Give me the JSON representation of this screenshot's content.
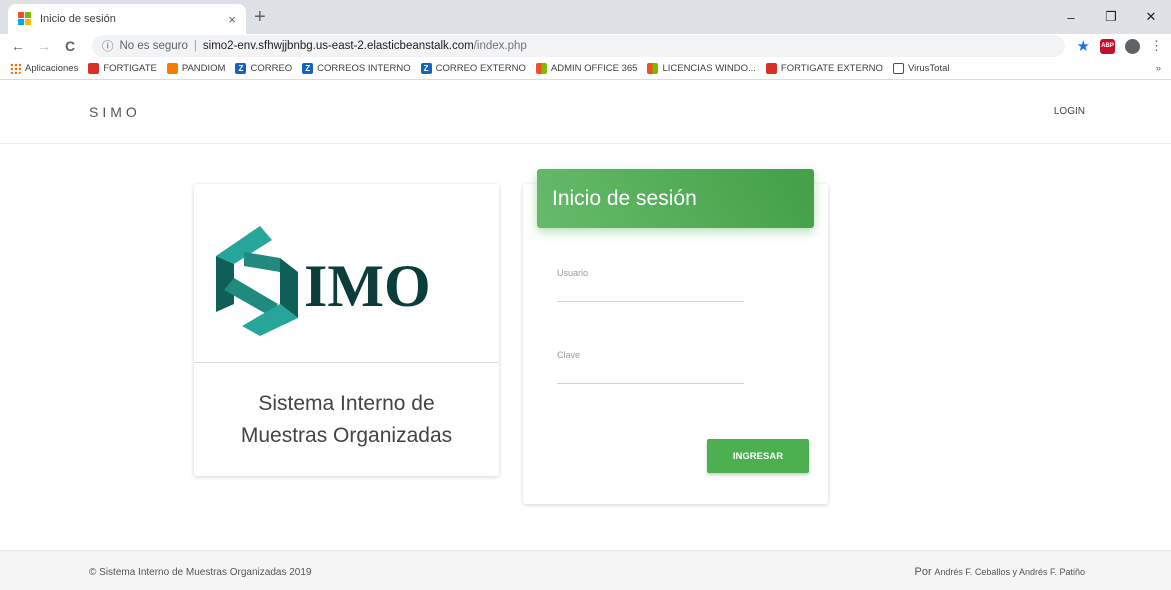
{
  "browser": {
    "tab_title": "Inicio de sesión",
    "tab_close": "×",
    "new_tab": "+",
    "window_controls": [
      "–",
      "❐",
      "✕"
    ],
    "nav": {
      "back": "←",
      "forward": "→",
      "reload": "C"
    },
    "security_icon": "ⓘ",
    "security_text": "No es seguro",
    "url_host": "simo2-env.sfhwjjbnbg.us-east-2.elasticbeanstalk.com",
    "url_path": "/index.php",
    "abp_label": "ABP",
    "bookmarks": [
      {
        "label": "Aplicaciones",
        "icon": "apps-icon"
      },
      {
        "label": "FORTIGATE",
        "icon": "fortigate-icon"
      },
      {
        "label": "PANDIOM",
        "icon": "pandiom-icon"
      },
      {
        "label": "CORREO",
        "icon": "zimbra-icon"
      },
      {
        "label": "CORREOS INTERNO",
        "icon": "zimbra-icon"
      },
      {
        "label": "CORREO EXTERNO",
        "icon": "zimbra-icon"
      },
      {
        "label": "ADMIN OFFICE 365",
        "icon": "microsoft-icon"
      },
      {
        "label": "LICENCIAS WINDO...",
        "icon": "microsoft-icon"
      },
      {
        "label": "FORTIGATE EXTERNO",
        "icon": "fortigate-icon"
      },
      {
        "label": "VirusTotal",
        "icon": "virustotal-icon"
      }
    ],
    "bookmarks_more": "»"
  },
  "site": {
    "brand": "SIMO",
    "login_link": "LOGIN",
    "logo_text": "IMO",
    "caption_line1": "Sistema Interno de",
    "caption_line2": "Muestras Organizadas",
    "form_title": "Inicio de sesión",
    "user_label": "Usuario",
    "user_value": "",
    "password_label": "Clave",
    "password_value": "",
    "submit_label": "INGRESAR",
    "footer_left": "© Sistema Interno de Muestras Organizadas 2019",
    "footer_right_prefix": "Por",
    "footer_right_names": "Andrés F. Ceballos y Andrés F. Patiño"
  },
  "colors": {
    "accent_green": "#4caf50",
    "logo_teal": "#1f8a7d",
    "logo_dark": "#0b3d3a"
  }
}
